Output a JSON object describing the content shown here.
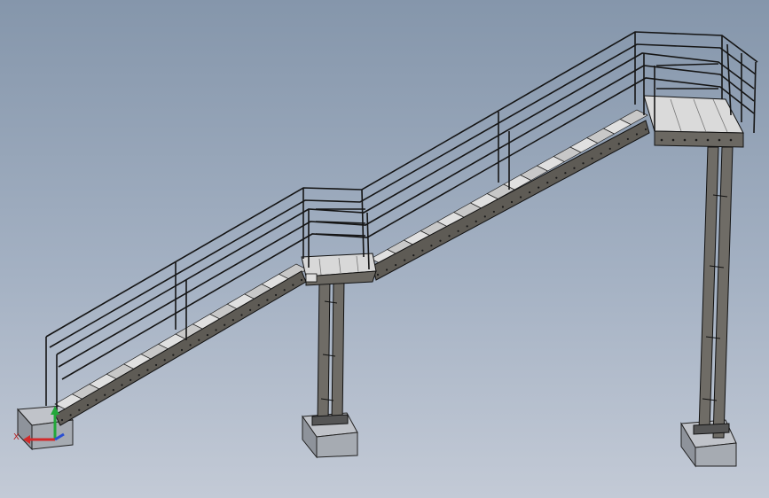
{
  "viewport": {
    "background_top": "#8596ab",
    "background_bottom": "#c3cad6"
  },
  "model": {
    "line_color": "#151515",
    "stringer_color": "#5e5b55",
    "tread_color": "#cfcfcf",
    "concrete_color": "#a9adb4"
  },
  "triad": {
    "x_label": "X",
    "x_color": "#d22a2a",
    "y_color": "#22a83a",
    "z_color": "#2a4fd2"
  }
}
